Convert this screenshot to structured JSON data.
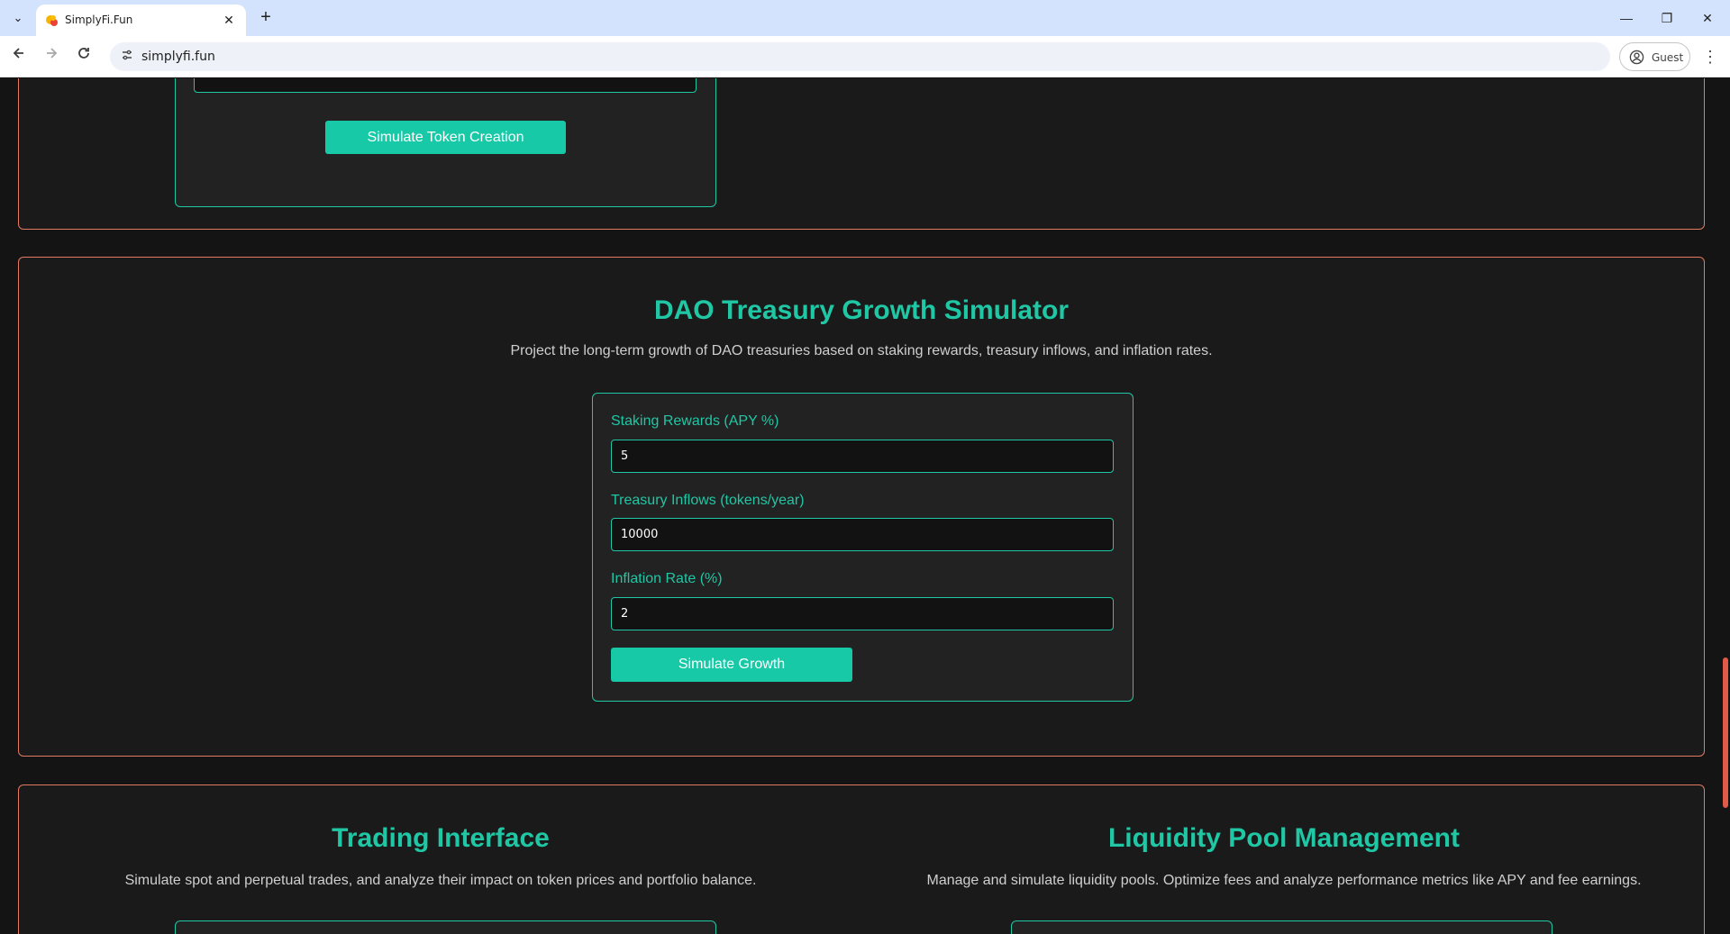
{
  "browser": {
    "tab_title": "SimplyFi.Fun",
    "tab_close": "✕",
    "new_tab": "+",
    "url": "simplyfi.fun",
    "profile_label": "Guest",
    "window_controls": {
      "minimize": "—",
      "restore": "❐",
      "close": "✕"
    }
  },
  "token_section": {
    "button_label": "Simulate Token Creation"
  },
  "dao_section": {
    "title": "DAO Treasury Growth Simulator",
    "description": "Project the long-term growth of DAO treasuries based on staking rewards, treasury inflows, and inflation rates.",
    "fields": [
      {
        "label": "Staking Rewards (APY %)",
        "value": "5"
      },
      {
        "label": "Treasury Inflows (tokens/year)",
        "value": "10000"
      },
      {
        "label": "Inflation Rate (%)",
        "value": "2"
      }
    ],
    "button_label": "Simulate Growth"
  },
  "trading_section": {
    "title": "Trading Interface",
    "description": "Simulate spot and perpetual trades, and analyze their impact on token prices and portfolio balance."
  },
  "liquidity_section": {
    "title": "Liquidity Pool Management",
    "description": "Manage and simulate liquidity pools. Optimize fees and analyze performance metrics like APY and fee earnings."
  },
  "colors": {
    "accent": "#1fc7a4",
    "section_border": "#e07a62",
    "page_bg": "#141414",
    "card_bg": "#222222",
    "tabstrip_bg": "#d3e3fd"
  },
  "icons": [
    "tab-list-icon",
    "favicon-icon",
    "close-icon",
    "plus-icon",
    "back-icon",
    "forward-icon",
    "reload-icon",
    "site-info-icon",
    "guest-avatar-icon",
    "kebab-menu-icon"
  ]
}
